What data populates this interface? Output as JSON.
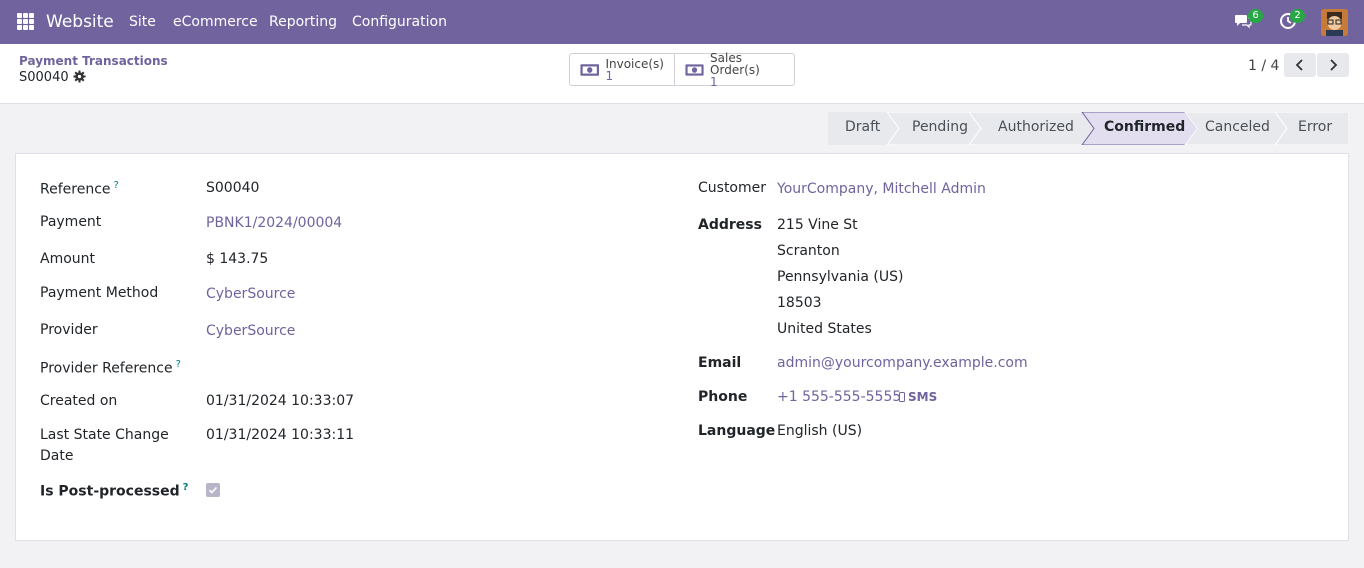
{
  "navbar": {
    "brand": "Website",
    "menu": [
      "Site",
      "eCommerce",
      "Reporting",
      "Configuration"
    ],
    "messages_count": "6",
    "activities_count": "2",
    "accent": "#71639e"
  },
  "control": {
    "breadcrumb_parent": "Payment Transactions",
    "record_name": "S00040",
    "smart_buttons": [
      {
        "label": "Invoice(s)",
        "count": "1",
        "icon": "money-icon"
      },
      {
        "label": "Sales Order(s)",
        "count": "1",
        "icon": "money-icon"
      }
    ],
    "pager": "1 / 4"
  },
  "statusbar": {
    "stages": [
      "Draft",
      "Pending",
      "Authorized",
      "Confirmed",
      "Canceled",
      "Error"
    ],
    "active": "Confirmed"
  },
  "form": {
    "left": {
      "reference_label": "Reference",
      "reference_value": "S00040",
      "payment_label": "Payment",
      "payment_value": "PBNK1/2024/00004",
      "amount_label": "Amount",
      "amount_value": "$ 143.75",
      "method_label": "Payment Method",
      "method_value": "CyberSource",
      "provider_label": "Provider",
      "provider_value": "CyberSource",
      "provider_ref_label": "Provider Reference",
      "created_label": "Created on",
      "created_value": "01/31/2024 10:33:07",
      "last_state_label_1": "Last State Change",
      "last_state_label_2": "Date",
      "last_state_value": "01/31/2024 10:33:11",
      "post_processed_label": "Is Post-processed",
      "post_processed_checked": true
    },
    "right": {
      "customer_label": "Customer",
      "customer_value": "YourCompany, Mitchell Admin",
      "address_label": "Address",
      "address_lines": [
        "215 Vine St",
        "Scranton",
        "Pennsylvania (US)",
        "18503",
        "United States"
      ],
      "email_label": "Email",
      "email_value": "admin@yourcompany.example.com",
      "phone_label": "Phone",
      "phone_value": "+1 555-555-5555",
      "sms_label": "SMS",
      "language_label": "Language",
      "language_value": "English (US)"
    },
    "help_mark": "?"
  }
}
